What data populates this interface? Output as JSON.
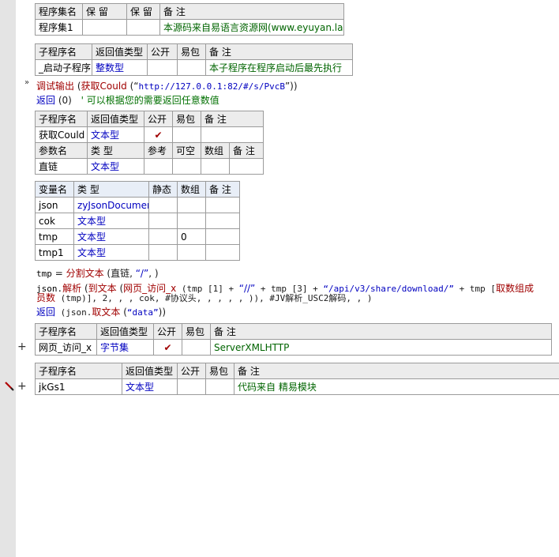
{
  "program_set": {
    "headers": [
      "程序集名",
      "保 留",
      "保 留",
      "备 注"
    ],
    "row": [
      "程序集1",
      "",
      "",
      "本源码来自易语言资源网(www.eyuyan.la)"
    ]
  },
  "startup_sub": {
    "headers": [
      "子程序名",
      "返回值类型",
      "公开",
      "易包",
      "备 注"
    ],
    "row": [
      "_启动子程序",
      "整数型",
      "",
      "",
      "本子程序在程序启动后最先执行"
    ]
  },
  "code1": {
    "debug_fn": "调试输出",
    "open": " (",
    "call_fn": "获取Could",
    "call_open": " (",
    "lq": "“",
    "url": "http://127.0.0.1:82/#/s/PvcB",
    "rq": "”",
    "close": "))",
    "ret_kw": "返回",
    "ret_arg": " (0)",
    "ret_comment": "' 可以根据您的需要返回任意数值"
  },
  "getcould_sub": {
    "headers": [
      "子程序名",
      "返回值类型",
      "公开",
      "易包",
      "备 注"
    ],
    "row": [
      "获取Could",
      "文本型",
      "✔",
      "",
      ""
    ],
    "param_headers": [
      "参数名",
      "类 型",
      "参考",
      "可空",
      "数组",
      "备 注"
    ],
    "param_row": [
      "直链",
      "文本型",
      "",
      "",
      "",
      ""
    ]
  },
  "vars": {
    "headers": [
      "变量名",
      "类 型",
      "静态",
      "数组",
      "备 注"
    ],
    "rows": [
      [
        "json",
        "zyJsonDocument",
        "",
        "",
        ""
      ],
      [
        "cok",
        "文本型",
        "",
        "",
        ""
      ],
      [
        "tmp",
        "文本型",
        "",
        "0",
        ""
      ],
      [
        "tmp1",
        "文本型",
        "",
        "",
        ""
      ]
    ]
  },
  "code2": {
    "l1_a": "tmp",
    "l1_b": " = ",
    "l1_fn": "分割文本",
    "l1_c": " (直链, ",
    "l1_d": "“/”",
    "l1_e": ", )",
    "l2_a": "json.",
    "l2_fn1": "解析",
    "l2_b": " (",
    "l2_fn2": "到文本",
    "l2_c": " (",
    "l2_fn3": "网页_访问_x",
    "l2_d": " (tmp [1] + ",
    "l2_s1": "“//”",
    "l2_e": " + tmp [3] + ",
    "l2_s2": "“/api/v3/share/download/”",
    "l2_f": " + tmp [",
    "l2_fn4": "取数组成",
    "l3_fn4b": "员数",
    "l3_a": " (tmp)], 2, , , cok, #协议头, , , , , )), #JV解析_USC2解码, , )",
    "l4_kw": "返回",
    "l4_a": " (json.",
    "l4_fn": "取文本",
    "l4_b": " (",
    "l4_s": "“data”",
    "l4_c": "))"
  },
  "webvisit_sub": {
    "headers": [
      "子程序名",
      "返回值类型",
      "公开",
      "易包",
      "备 注"
    ],
    "row": [
      "网页_访问_x",
      "字节集",
      "✔",
      "",
      "ServerXMLHTTP"
    ],
    "expand": "+"
  },
  "jkgs_sub": {
    "headers": [
      "子程序名",
      "返回值类型",
      "公开",
      "易包",
      "备 注"
    ],
    "row": [
      "jkGs1",
      "文本型",
      "",
      "",
      "代码来自 精易模块"
    ],
    "expand": "+"
  }
}
